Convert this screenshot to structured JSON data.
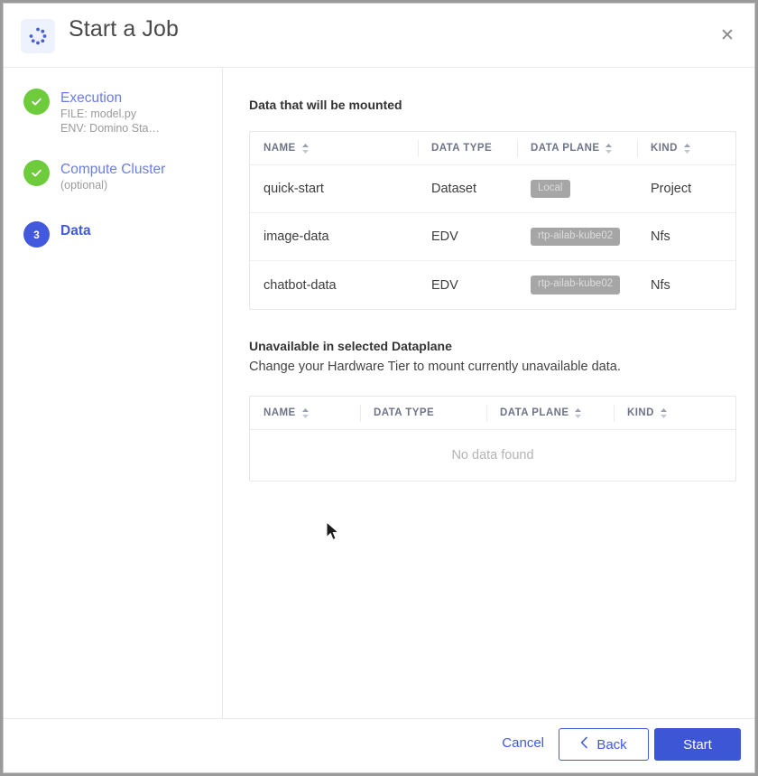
{
  "header": {
    "title": "Start a Job",
    "logo_icon": "spinner-dots-icon",
    "close_icon": "close-icon"
  },
  "sidebar": {
    "steps": [
      {
        "label": "Execution",
        "state": "done",
        "marker": "check-icon",
        "sub1": "FILE: model.py",
        "sub2": "ENV: Domino Sta…"
      },
      {
        "label": "Compute Cluster",
        "state": "done",
        "marker": "check-icon",
        "sub1": "(optional)",
        "sub2": ""
      },
      {
        "label": "Data",
        "state": "active",
        "marker": "3",
        "sub1": "",
        "sub2": ""
      }
    ]
  },
  "main": {
    "mounted_section": {
      "title": "Data that will be mounted",
      "columns": [
        {
          "label": "NAME",
          "sortable": true
        },
        {
          "label": "DATA TYPE",
          "sortable": false
        },
        {
          "label": "DATA PLANE",
          "sortable": true
        },
        {
          "label": "KIND",
          "sortable": true
        }
      ],
      "rows": [
        {
          "name": "quick-start",
          "data_type": "Dataset",
          "data_plane": "Local",
          "kind": "Project"
        },
        {
          "name": "image-data",
          "data_type": "EDV",
          "data_plane": "rtp-ailab-kube02",
          "kind": "Nfs"
        },
        {
          "name": "chatbot-data",
          "data_type": "EDV",
          "data_plane": "rtp-ailab-kube02",
          "kind": "Nfs"
        }
      ]
    },
    "unavailable_section": {
      "title": "Unavailable in selected Dataplane",
      "description": "Change your Hardware Tier to mount currently unavailable data.",
      "columns": [
        {
          "label": "NAME",
          "sortable": true
        },
        {
          "label": "DATA TYPE",
          "sortable": false
        },
        {
          "label": "DATA PLANE",
          "sortable": true
        },
        {
          "label": "KIND",
          "sortable": true
        }
      ],
      "empty_text": "No data found"
    }
  },
  "footer": {
    "cancel_label": "Cancel",
    "back_label": "Back",
    "back_icon": "chevron-left-icon",
    "start_label": "Start"
  },
  "colors": {
    "accent_blue": "#4258dd",
    "primary_button": "#3d56d6",
    "success_green": "#6ecb3c",
    "badge_gray": "#a6a6a6",
    "logo_bg": "#eef2fd"
  }
}
